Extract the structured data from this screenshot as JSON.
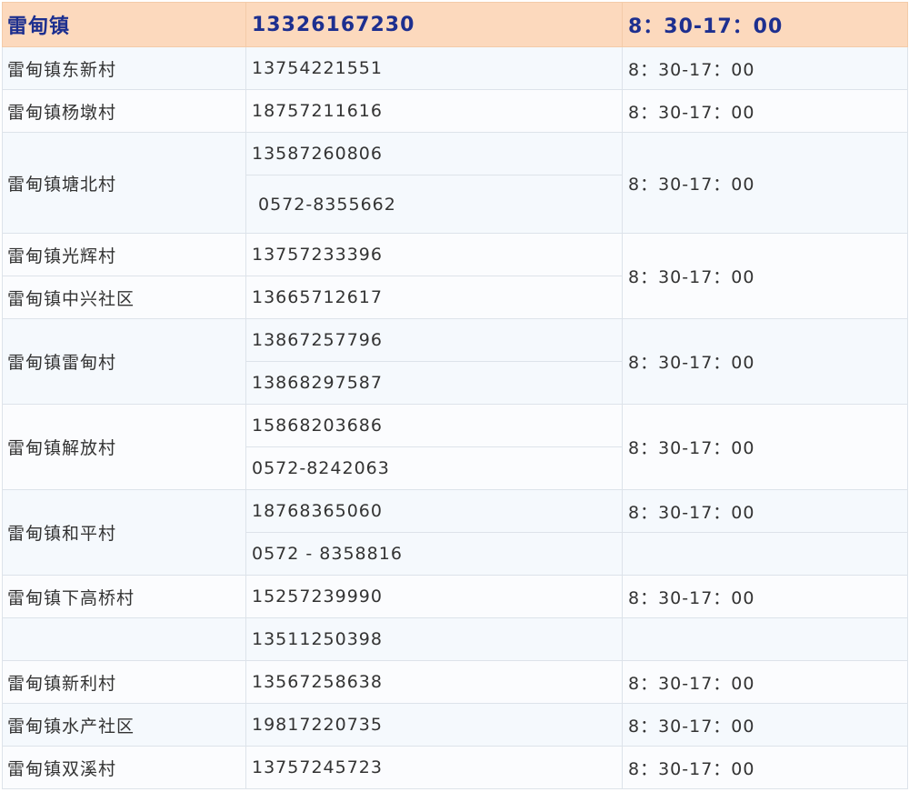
{
  "header": {
    "name": "雷甸镇",
    "phone": "13326167230",
    "hours": "8：30-17：00"
  },
  "rows": [
    {
      "name": "雷甸镇东新村",
      "phone": "13754221551",
      "hours": "8：30-17：00"
    },
    {
      "name": "雷甸镇杨墩村",
      "phone": "18757211616",
      "hours": "8：30-17：00"
    },
    {
      "name": "雷甸镇塘北村",
      "phones": [
        "13587260806",
        "0572-8355662"
      ],
      "hours": "8：30-17：00"
    },
    {
      "name_a": "雷甸镇光辉村",
      "phone_a": "13757233396",
      "name_b": "雷甸镇中兴社区",
      "phone_b": "13665712617",
      "hours": "8：30-17：00"
    },
    {
      "name": "雷甸镇雷甸村",
      "phones": [
        "13867257796",
        "13868297587"
      ],
      "hours": "8：30-17：00"
    },
    {
      "name": "雷甸镇解放村",
      "phones": [
        "15868203686",
        "0572-8242063"
      ],
      "hours": "8：30-17：00"
    },
    {
      "name": "雷甸镇和平村",
      "phones": [
        "18768365060",
        "0572 - 8358816"
      ],
      "hours": "8：30-17：00"
    },
    {
      "name": "雷甸镇下高桥村",
      "phone": "15257239990",
      "hours": "8：30-17：00"
    },
    {
      "name": "",
      "phone": "13511250398",
      "hours": ""
    },
    {
      "name": "雷甸镇新利村",
      "phone": "13567258638",
      "hours": "8：30-17：00"
    },
    {
      "name": "雷甸镇水产社区",
      "phone": "19817220735",
      "hours": "8：30-17：00"
    },
    {
      "name": "雷甸镇双溪村",
      "phone": "13757245723",
      "hours": "8：30-17：00"
    }
  ]
}
